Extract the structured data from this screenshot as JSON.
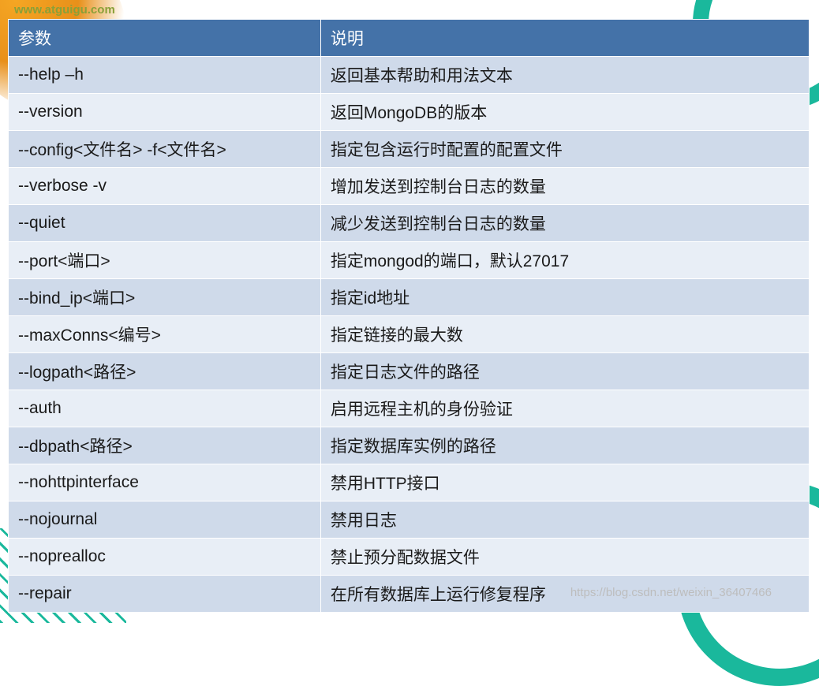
{
  "url_hint": "www.atguigu.com",
  "table": {
    "headers": {
      "param": "参数",
      "desc": "说明"
    },
    "rows": [
      {
        "param": "--help –h",
        "desc": "返回基本帮助和用法文本"
      },
      {
        "param": "--version",
        "desc": "返回MongoDB的版本"
      },
      {
        "param": "--config<文件名>    -f<文件名>",
        "desc": "指定包含运行时配置的配置文件"
      },
      {
        "param": "--verbose     -v",
        "desc": "增加发送到控制台日志的数量"
      },
      {
        "param": "--quiet",
        "desc": "减少发送到控制台日志的数量"
      },
      {
        "param": "--port<端口>",
        "desc": "指定mongod的端口，默认27017"
      },
      {
        "param": "--bind_ip<端口>",
        "desc": "指定id地址"
      },
      {
        "param": "--maxConns<编号>",
        "desc": "指定链接的最大数"
      },
      {
        "param": "--logpath<路径>",
        "desc": "指定日志文件的路径"
      },
      {
        "param": "--auth",
        "desc": "启用远程主机的身份验证"
      },
      {
        "param": "--dbpath<路径>",
        "desc": "指定数据库实例的路径"
      },
      {
        "param": "--nohttpinterface",
        "desc": "禁用HTTP接口"
      },
      {
        "param": "--nojournal",
        "desc": "禁用日志"
      },
      {
        "param": "--noprealloc",
        "desc": "禁止预分配数据文件"
      },
      {
        "param": "--repair",
        "desc": "在所有数据库上运行修复程序"
      }
    ]
  },
  "watermark": "https://blog.csdn.net/weixin_36407466"
}
